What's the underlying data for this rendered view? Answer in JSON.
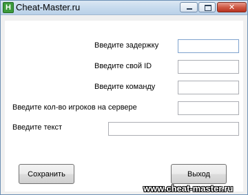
{
  "window": {
    "title": "Cheat-Master.ru",
    "icon_letter": "H",
    "close_glyph": "✕"
  },
  "form": {
    "delay_label": "Введите задержку",
    "delay_value": "",
    "id_label": "Введите свой ID",
    "id_value": "",
    "command_label": "Введите команду",
    "command_value": "",
    "players_label": "Введите кол-во игроков на сервере",
    "players_value": "",
    "text_label": "Введите текст",
    "text_value": ""
  },
  "buttons": {
    "save_label": "Сохранить",
    "exit_label": "Выход"
  },
  "watermark": "www.cheat-master.ru",
  "colors": {
    "title_bar": "#c9dcee",
    "close_button": "#cf5a45",
    "app_icon": "#3c9a3c"
  }
}
